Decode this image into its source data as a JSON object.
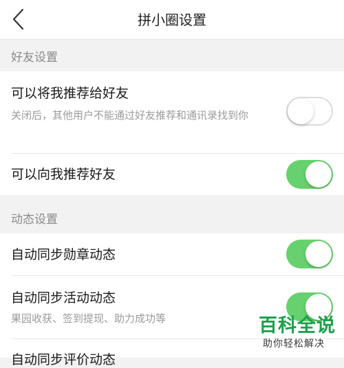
{
  "header": {
    "title": "拼小圈设置",
    "back_icon": "chevron-left-icon"
  },
  "sections": [
    {
      "label": "好友设置",
      "items": [
        {
          "title": "可以将我推荐给好友",
          "description": "关闭后，其他用户不能通过好友推荐和通讯录找到你",
          "enabled": false
        },
        {
          "title": "可以向我推荐好友",
          "enabled": true
        }
      ]
    },
    {
      "label": "动态设置",
      "items": [
        {
          "title": "自动同步勋章动态",
          "enabled": true
        },
        {
          "title": "自动同步活动动态",
          "description": "果园收获、签到提现、助力成功等",
          "enabled": true
        },
        {
          "title": "自动同步评价动态"
        }
      ]
    }
  ],
  "watermark": {
    "title": "百科全说",
    "subtitle": "助你轻松解决"
  },
  "colors": {
    "toggle_on": "#66d16e",
    "toggle_off_border": "#dcdcdc",
    "section_bg": "#f2f2f2",
    "watermark": "#1aa14b"
  }
}
